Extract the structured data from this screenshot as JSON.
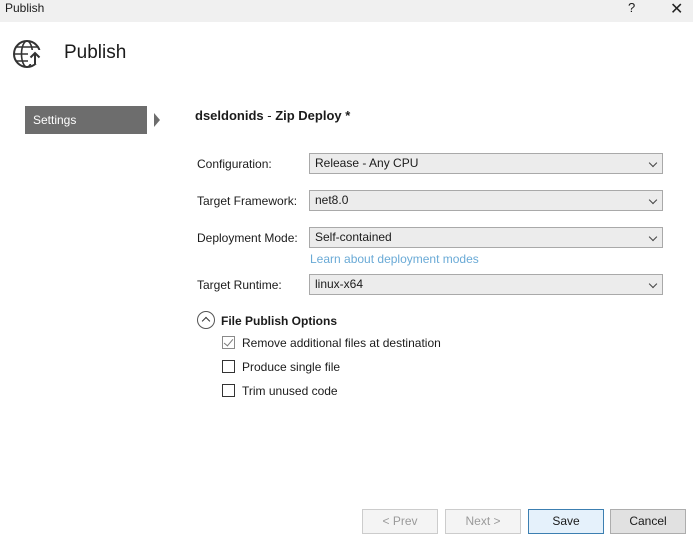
{
  "window": {
    "title": "Publish",
    "help_label": "?",
    "close_label": "✕"
  },
  "header": {
    "title": "Publish",
    "icon": "globe-publish-icon"
  },
  "sidebar": {
    "items": [
      {
        "label": "Settings",
        "selected": true
      }
    ]
  },
  "profile": {
    "name": "dseldonids",
    "separator": " - ",
    "type": "Zip Deploy *"
  },
  "form": {
    "configuration": {
      "label": "Configuration:",
      "value": "Release - Any CPU"
    },
    "target_framework": {
      "label": "Target Framework:",
      "value": "net8.0"
    },
    "deployment_mode": {
      "label": "Deployment Mode:",
      "value": "Self-contained"
    },
    "deployment_link": "Learn about deployment modes",
    "target_runtime": {
      "label": "Target Runtime:",
      "value": "linux-x64"
    }
  },
  "file_publish_options": {
    "title": "File Publish Options",
    "options": [
      {
        "label": "Remove additional files at destination",
        "checked": true
      },
      {
        "label": "Produce single file",
        "checked": false
      },
      {
        "label": "Trim unused code",
        "checked": false
      }
    ]
  },
  "buttons": {
    "prev": "< Prev",
    "next": "Next >",
    "save": "Save",
    "cancel": "Cancel"
  }
}
